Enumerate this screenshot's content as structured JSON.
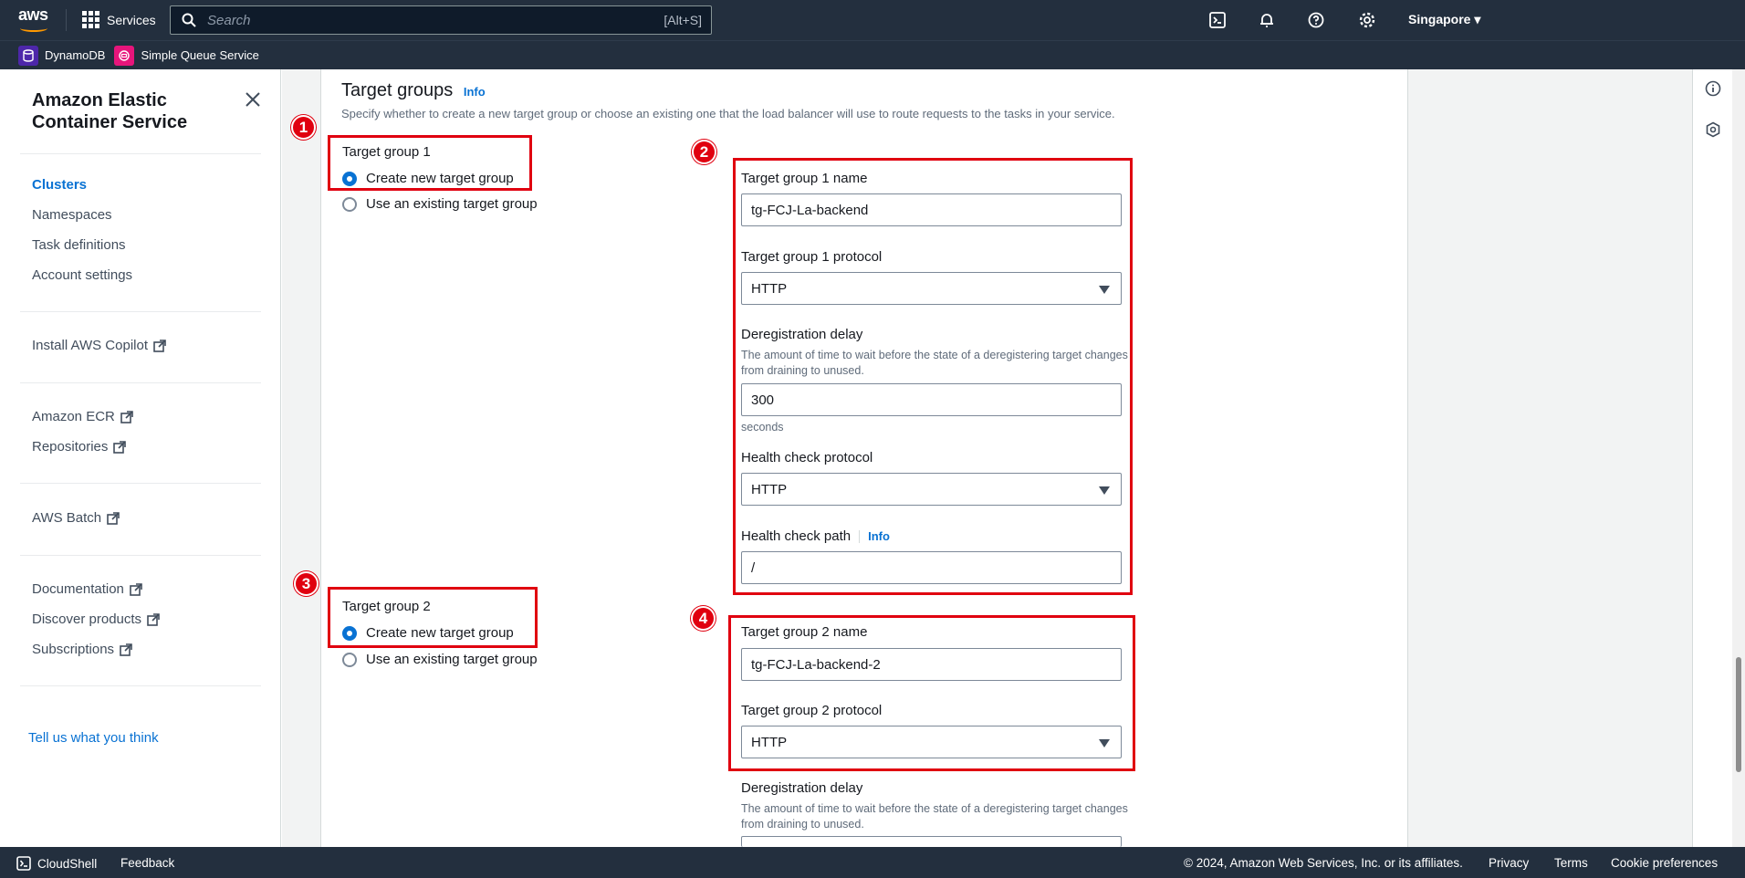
{
  "topbar": {
    "logo_text": "aws",
    "services_label": "Services",
    "search_placeholder": "Search",
    "search_shortcut": "[Alt+S]",
    "region": "Singapore",
    "icons": [
      "cloudshell-icon",
      "bell-icon",
      "help-icon",
      "settings-icon"
    ]
  },
  "favorites": [
    {
      "label": "DynamoDB",
      "color": "#4d27aa"
    },
    {
      "label": "Simple Queue Service",
      "color": "#e7157b"
    }
  ],
  "sidebar": {
    "title": "Amazon Elastic Container Service",
    "nav": [
      "Clusters",
      "Namespaces",
      "Task definitions",
      "Account settings"
    ],
    "copilot": "Install AWS Copilot",
    "ecr": "Amazon ECR",
    "repositories": "Repositories",
    "batch": "AWS Batch",
    "documentation": "Documentation",
    "discover": "Discover products",
    "subscriptions": "Subscriptions",
    "tell": "Tell us what you think"
  },
  "section": {
    "title": "Target groups",
    "info": "Info",
    "description": "Specify whether to create a new target group or choose an existing one that the load balancer will use to route requests to the tasks in your service."
  },
  "tg1": {
    "label": "Target group 1",
    "opt_new": "Create new target group",
    "opt_existing": "Use an existing target group",
    "name_label": "Target group 1 name",
    "name_value": "tg-FCJ-La-backend",
    "protocol_label": "Target group 1 protocol",
    "protocol_value": "HTTP",
    "dereg_label": "Deregistration delay",
    "dereg_desc": "The amount of time to wait before the state of a deregistering target changes from draining to unused.",
    "dereg_value": "300",
    "dereg_unit": "seconds",
    "hc_protocol_label": "Health check protocol",
    "hc_protocol_value": "HTTP",
    "hc_path_label": "Health check path",
    "hc_path_info": "Info",
    "hc_path_value": "/"
  },
  "tg2": {
    "label": "Target group 2",
    "opt_new": "Create new target group",
    "opt_existing": "Use an existing target group",
    "name_label": "Target group 2 name",
    "name_value": "tg-FCJ-La-backend-2",
    "protocol_label": "Target group 2 protocol",
    "protocol_value": "HTTP",
    "dereg_label": "Deregistration delay",
    "dereg_desc": "The amount of time to wait before the state of a deregistering target changes from draining to unused."
  },
  "badges": [
    "1",
    "2",
    "3",
    "4"
  ],
  "footer": {
    "cloudshell": "CloudShell",
    "feedback": "Feedback",
    "copyright": "© 2024, Amazon Web Services, Inc. or its affiliates.",
    "privacy": "Privacy",
    "terms": "Terms",
    "cookies": "Cookie preferences"
  },
  "colors": {
    "accent": "#0972d3",
    "annotation": "#e0000f",
    "nav_bg": "#232f3e"
  }
}
